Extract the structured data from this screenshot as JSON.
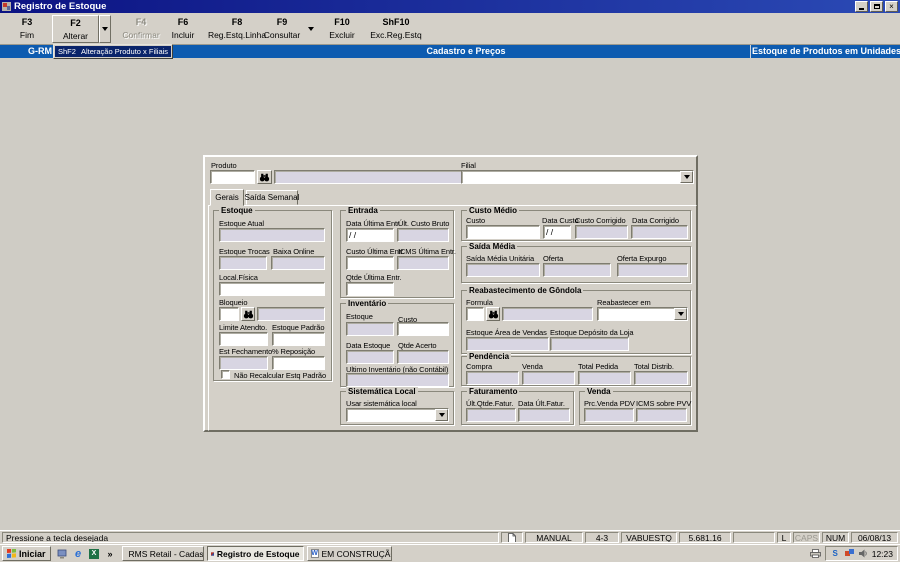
{
  "window": {
    "title": "Registro de Estoque"
  },
  "icons": {
    "dropdown": "▼",
    "overflow": "»",
    "close": "×"
  },
  "toolbar": {
    "items": [
      {
        "key": "F3",
        "label": "Fim"
      },
      {
        "key": "F2",
        "label": "Alterar"
      },
      {
        "key": "F4",
        "label": "Confirmar"
      },
      {
        "key": "F6",
        "label": "Incluir"
      },
      {
        "key": "F8",
        "label": "Reg.Estq.Linha"
      },
      {
        "key": "F9",
        "label": "Consultar"
      },
      {
        "key": "F10",
        "label": "Excluir"
      },
      {
        "key": "ShF10",
        "label": "Exc.Reg.Estq"
      }
    ]
  },
  "menu": {
    "shortcut": "ShF2",
    "label": "Alteração Produto x Filiais"
  },
  "header": {
    "left": "G-RM",
    "center": "Cadastro e Preços",
    "right": "Estoque de Produtos em Unidades"
  },
  "form": {
    "produto_label": "Produto",
    "filial_label": "Filial",
    "tabs": [
      "Gerais",
      "Saída Semanal"
    ],
    "estoque": {
      "title": "Estoque",
      "estoque_atual": "Estoque Atual",
      "estoque_trocas": "Estoque Trocas",
      "baixa_online": "Baixa Online",
      "local_fisica": "Local.Física",
      "bloqueio": "Bloqueio",
      "limite_atendto": "Limite Atendto.",
      "estoque_padrao": "Estoque Padrão",
      "est_fechamento": "Est Fechamento",
      "pct_reposicao": "% Reposição",
      "nao_recalcular": "Não Recalcular Estq Padrão"
    },
    "entrada": {
      "title": "Entrada",
      "data_ultima": "Data Última Entr.",
      "ult_custo_bruto": "Últ. Custo Bruto",
      "custo_ultima": "Custo Última Entr.",
      "icms_ultima": "ICMS Última Entr.",
      "qtde_ultima": "Qtde Última Entr.",
      "data_value": "/ /"
    },
    "inventario": {
      "title": "Inventário",
      "estoque": "Estoque",
      "custo": "Custo",
      "data_estoque": "Data Estoque",
      "qtde_acerto": "Qtde Acerto",
      "ultimo_inv": "Ultimo Inventário (não Contábil)"
    },
    "sistematica": {
      "title": "Sistemática Local",
      "usar": "Usar sistemática local"
    },
    "custo_medio": {
      "title": "Custo Médio",
      "custo": "Custo",
      "data_custo": "Data Custo",
      "custo_corrigido": "Custo Corrigido",
      "data_corrigido": "Data Corrigido",
      "data_value": "/ /"
    },
    "saida_media": {
      "title": "Saída Média",
      "unitaria": "Saída Média Unitária",
      "oferta": "Oferta",
      "oferta_expurgo": "Oferta Expurgo"
    },
    "reabastecimento": {
      "title": "Reabastecimento de Gôndola",
      "formula": "Formula",
      "reabastecer_em": "Reabastecer em",
      "area_vendas": "Estoque Área de Vendas",
      "deposito_loja": "Estoque Depósito da Loja"
    },
    "pendencia": {
      "title": "Pendência",
      "compra": "Compra",
      "venda": "Venda",
      "total_pedida": "Total Pedida",
      "total_distrib": "Total  Distrib."
    },
    "faturamento": {
      "title": "Faturamento",
      "ult_qtde": "Últ.Qtde.Fatur.",
      "data_ult": "Data Últ.Fatur."
    },
    "venda": {
      "title": "Venda",
      "prc_venda": "Prc.Venda PDV",
      "icms_pvv": "ICMS sobre PVV"
    }
  },
  "statusbar": {
    "message": "Pressione a tecla desejada",
    "mode": "MANUAL",
    "position": "4-3",
    "program": "VABUESTQ",
    "version": "5.681.16",
    "l": "L",
    "caps": "CAPS",
    "num": "NUM",
    "date": "06/08/13"
  },
  "taskbar": {
    "start": "Iniciar",
    "tasks": [
      "RMS Retail - Cadastro / ...",
      "Registro de Estoque",
      "EM CONSTRUÇÃO_RMS ..."
    ],
    "clock": "12:23"
  }
}
